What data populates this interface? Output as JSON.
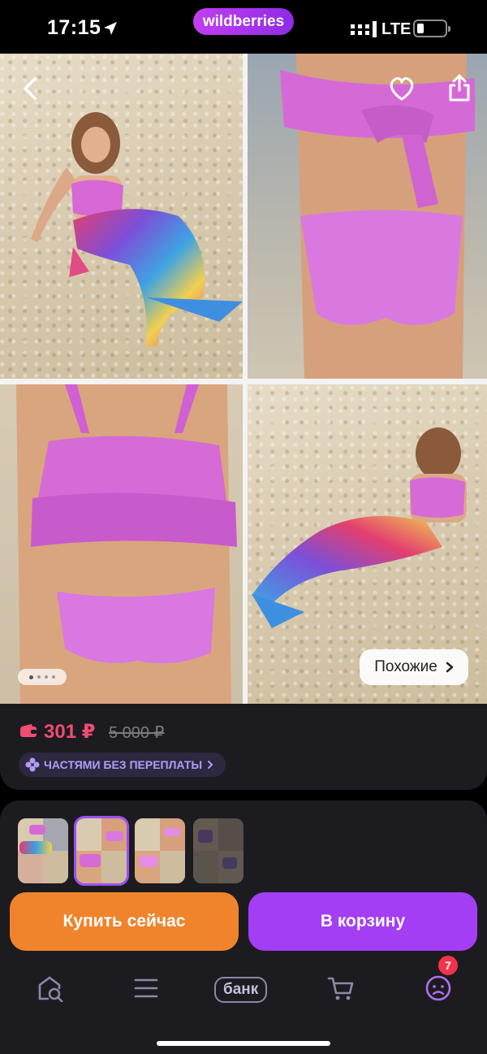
{
  "status_bar": {
    "time": "17:15",
    "network": "LTE",
    "brand": "wildberries"
  },
  "gallery": {
    "icons": {
      "back": "chevron-left-icon",
      "favorite": "heart-icon",
      "share": "share-icon",
      "similar_arrow": "chevron-right-icon"
    },
    "current_page": 1,
    "page_count": 4,
    "similar_label": "Похожие"
  },
  "price": {
    "current": "301 ₽",
    "old": "5 000 ₽",
    "installments_label": "ЧАСТЯМИ БЕЗ ПЕРЕПЛАТЫ",
    "colors": {
      "current": "#f14c72",
      "installments": "#b49cf5"
    }
  },
  "variants": {
    "count": 4,
    "selected_index": 1
  },
  "actions": {
    "buy_now": "Купить сейчас",
    "add_to_cart": "В корзину",
    "colors": {
      "buy_now": "#f0842c",
      "add_to_cart": "#a33ef4"
    }
  },
  "tabbar": {
    "items": [
      {
        "icon": "home-search-icon"
      },
      {
        "icon": "menu-icon"
      },
      {
        "label": "банк"
      },
      {
        "icon": "cart-icon"
      },
      {
        "icon": "profile-icon",
        "badge": "7"
      }
    ]
  }
}
